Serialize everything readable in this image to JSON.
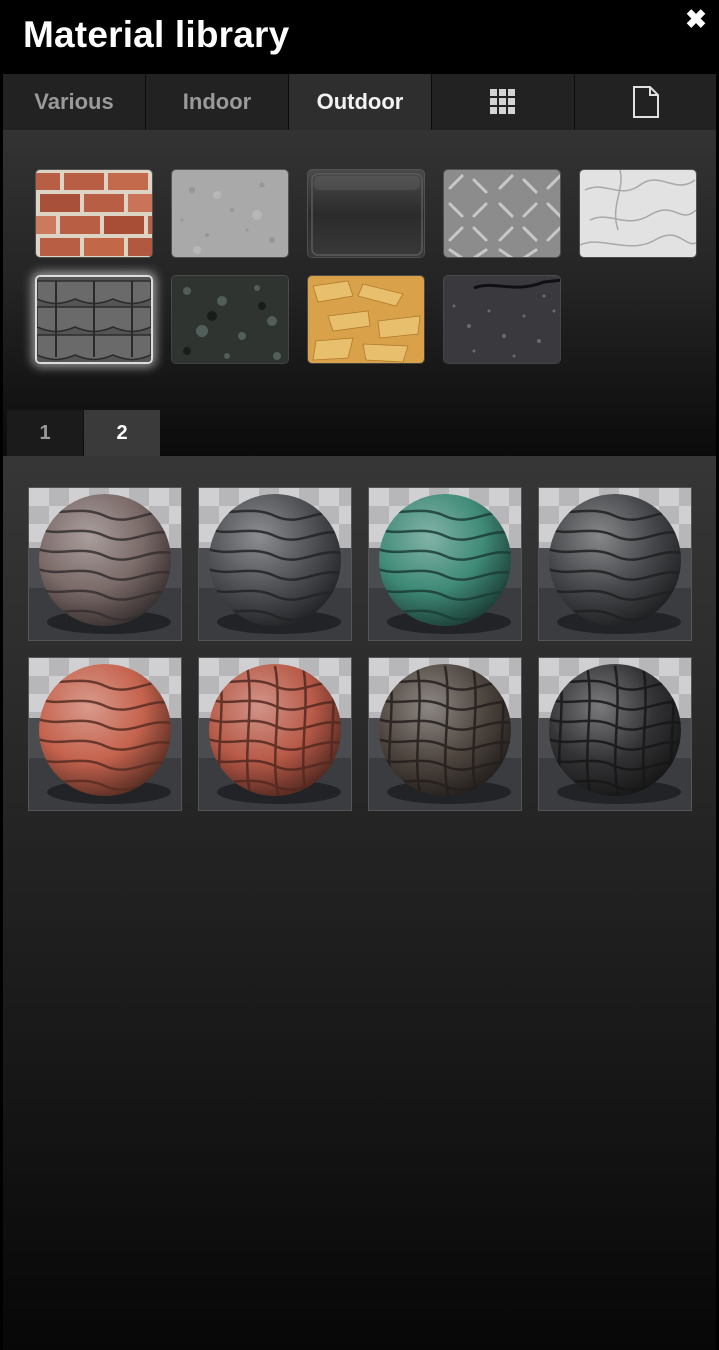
{
  "window": {
    "title": "Material library",
    "close_icon": "close-icon"
  },
  "tabs": [
    {
      "label": "Various",
      "active": false
    },
    {
      "label": "Indoor",
      "active": false
    },
    {
      "label": "Outdoor",
      "active": true
    },
    {
      "icon": "grid-icon",
      "active": false
    },
    {
      "icon": "document-icon",
      "active": false
    }
  ],
  "categories": [
    {
      "name": "brick",
      "color": "#b8644a"
    },
    {
      "name": "concrete",
      "color": "#a8a8a8"
    },
    {
      "name": "glass",
      "color": "#3a3a3a"
    },
    {
      "name": "metal-plate",
      "color": "#8a8a8a"
    },
    {
      "name": "plaster",
      "color": "#e0e0e0"
    },
    {
      "name": "roof-tiles",
      "color": "#5a5a5a",
      "selected": true
    },
    {
      "name": "granite",
      "color": "#3b403c"
    },
    {
      "name": "osb-wood",
      "color": "#d9a24a"
    },
    {
      "name": "asphalt",
      "color": "#3c3c40"
    }
  ],
  "pages": [
    {
      "label": "1",
      "active": false
    },
    {
      "label": "2",
      "active": true
    }
  ],
  "materials": [
    {
      "name": "roof-tile-brown-gray",
      "color": "#7a6a68"
    },
    {
      "name": "roof-tile-dark-gray",
      "color": "#4e5054"
    },
    {
      "name": "roof-tile-green",
      "color": "#3f8a78"
    },
    {
      "name": "roof-tile-charcoal",
      "color": "#45474a"
    },
    {
      "name": "roof-tile-red-scalloped",
      "color": "#c5634e"
    },
    {
      "name": "roof-tile-red-flat",
      "color": "#b85a48"
    },
    {
      "name": "roof-tile-brown-flat",
      "color": "#4f4640"
    },
    {
      "name": "roof-tile-black-flat",
      "color": "#333335"
    }
  ]
}
